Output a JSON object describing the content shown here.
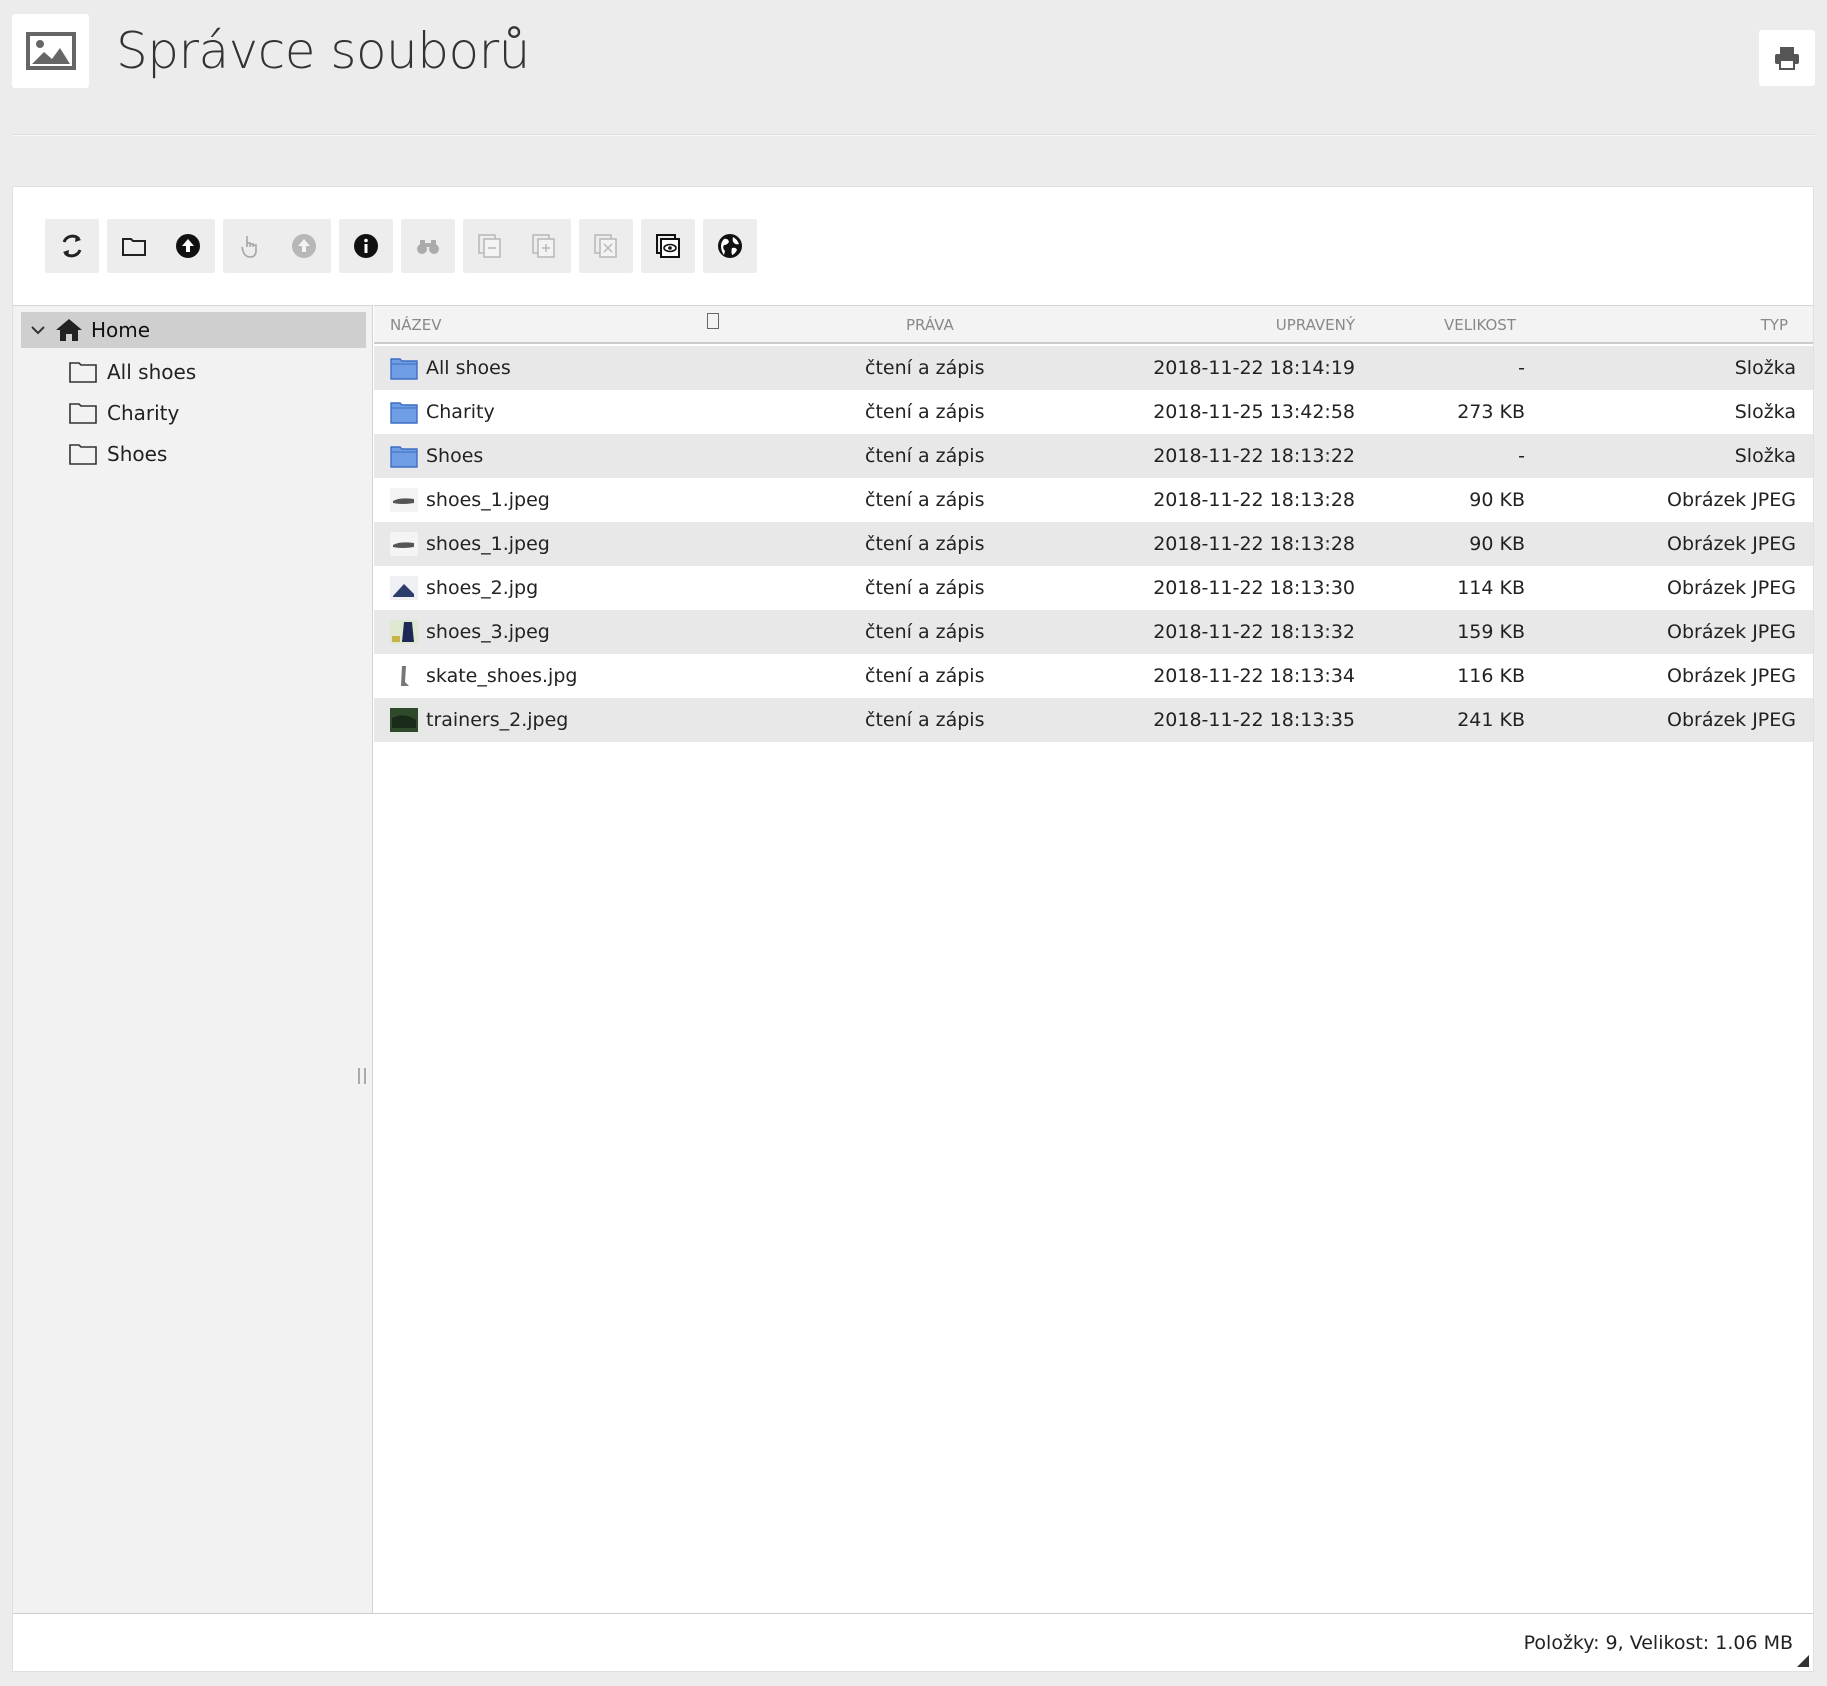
{
  "header": {
    "title": "Správce souborů",
    "logo_icon": "image-icon",
    "print_icon": "print-icon"
  },
  "toolbar": {
    "groups": [
      [
        {
          "icon": "refresh-icon",
          "enabled": true
        }
      ],
      [
        {
          "icon": "folder-icon",
          "enabled": true
        },
        {
          "icon": "upload-icon",
          "enabled": true
        }
      ],
      [
        {
          "icon": "hand-pointer-icon",
          "enabled": false
        },
        {
          "icon": "upload-circle-icon",
          "enabled": false
        }
      ],
      [
        {
          "icon": "info-icon",
          "enabled": true
        }
      ],
      [
        {
          "icon": "binoculars-icon",
          "enabled": false
        }
      ],
      [
        {
          "icon": "copy-minus-icon",
          "enabled": false
        },
        {
          "icon": "copy-plus-icon",
          "enabled": false
        }
      ],
      [
        {
          "icon": "delete-icon",
          "enabled": false
        }
      ],
      [
        {
          "icon": "preview-icon",
          "enabled": true
        }
      ],
      [
        {
          "icon": "globe-icon",
          "enabled": true
        }
      ]
    ]
  },
  "tree": {
    "root": "Home",
    "children": [
      "All shoes",
      "Charity",
      "Shoes"
    ]
  },
  "list": {
    "columns": {
      "name": "Název",
      "perm": "Práva",
      "modified": "Upravený",
      "size": "Velikost",
      "type": "Typ"
    },
    "rows": [
      {
        "name": "All shoes",
        "perm": "čtení a zápis",
        "modified": "2018-11-22 18:14:19",
        "size": "-",
        "type": "Složka",
        "icon": "folder"
      },
      {
        "name": "Charity",
        "perm": "čtení a zápis",
        "modified": "2018-11-25 13:42:58",
        "size": "273 KB",
        "type": "Složka",
        "icon": "folder"
      },
      {
        "name": "Shoes",
        "perm": "čtení a zápis",
        "modified": "2018-11-22 18:13:22",
        "size": "-",
        "type": "Složka",
        "icon": "folder"
      },
      {
        "name": "shoes_1.jpeg",
        "perm": "čtení a zápis",
        "modified": "2018-11-22 18:13:28",
        "size": "90 KB",
        "type": "Obrázek JPEG",
        "icon": "thumb1"
      },
      {
        "name": "shoes_1.jpeg",
        "perm": "čtení a zápis",
        "modified": "2018-11-22 18:13:28",
        "size": "90 KB",
        "type": "Obrázek JPEG",
        "icon": "thumb1"
      },
      {
        "name": "shoes_2.jpg",
        "perm": "čtení a zápis",
        "modified": "2018-11-22 18:13:30",
        "size": "114 KB",
        "type": "Obrázek JPEG",
        "icon": "thumb2"
      },
      {
        "name": "shoes_3.jpeg",
        "perm": "čtení a zápis",
        "modified": "2018-11-22 18:13:32",
        "size": "159 KB",
        "type": "Obrázek JPEG",
        "icon": "thumb3"
      },
      {
        "name": "skate_shoes.jpg",
        "perm": "čtení a zápis",
        "modified": "2018-11-22 18:13:34",
        "size": "116 KB",
        "type": "Obrázek JPEG",
        "icon": "thumb4"
      },
      {
        "name": "trainers_2.jpeg",
        "perm": "čtení a zápis",
        "modified": "2018-11-22 18:13:35",
        "size": "241 KB",
        "type": "Obrázek JPEG",
        "icon": "thumb5"
      }
    ]
  },
  "status": {
    "text": "Položky: 9, Velikost: 1.06 MB"
  }
}
